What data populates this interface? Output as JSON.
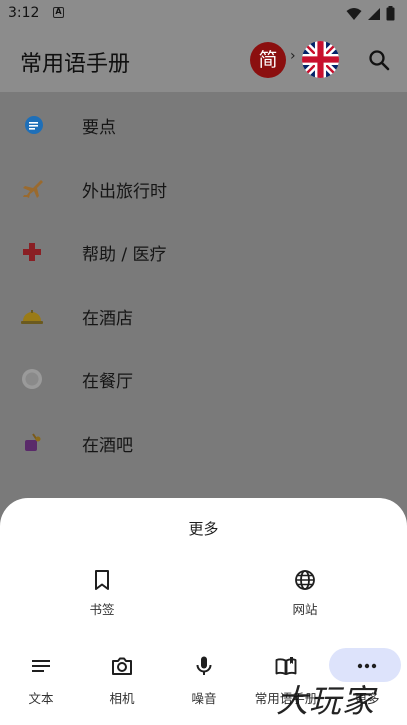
{
  "status_bar": {
    "time": "3:12",
    "notification_icon": "A"
  },
  "app_bar": {
    "title": "常用语手册",
    "source_language_glyph": "简",
    "arrow": "›",
    "target_language_icon": "uk-flag-icon",
    "search_icon": "search-icon"
  },
  "topics": [
    {
      "label": "要点",
      "icon": "speech-bubble-icon",
      "color": "#1e88e5"
    },
    {
      "label": "外出旅行时",
      "icon": "airplane-icon",
      "color": "#f09e28"
    },
    {
      "label": "帮助 / 医疗",
      "icon": "medical-cross-icon",
      "color": "#e0222b"
    },
    {
      "label": "在酒店",
      "icon": "service-bell-icon",
      "color": "#f4b400"
    },
    {
      "label": "在餐厅",
      "icon": "plate-icon",
      "color": "#cfcfcf"
    },
    {
      "label": "在酒吧",
      "icon": "cocktail-icon",
      "color": "#8e24aa"
    }
  ],
  "sheet": {
    "title": "更多",
    "actions": [
      {
        "label": "书签",
        "icon": "bookmark-icon"
      },
      {
        "label": "网站",
        "icon": "globe-icon"
      }
    ]
  },
  "bottom_nav": [
    {
      "label": "文本",
      "icon": "text-lines-icon"
    },
    {
      "label": "相机",
      "icon": "camera-icon"
    },
    {
      "label": "噪音",
      "icon": "microphone-icon"
    },
    {
      "label": "常用语手册",
      "icon": "phrasebook-icon"
    },
    {
      "label": "更多",
      "icon": "more-horizontal-icon",
      "active": true
    }
  ],
  "watermark": "大玩家"
}
